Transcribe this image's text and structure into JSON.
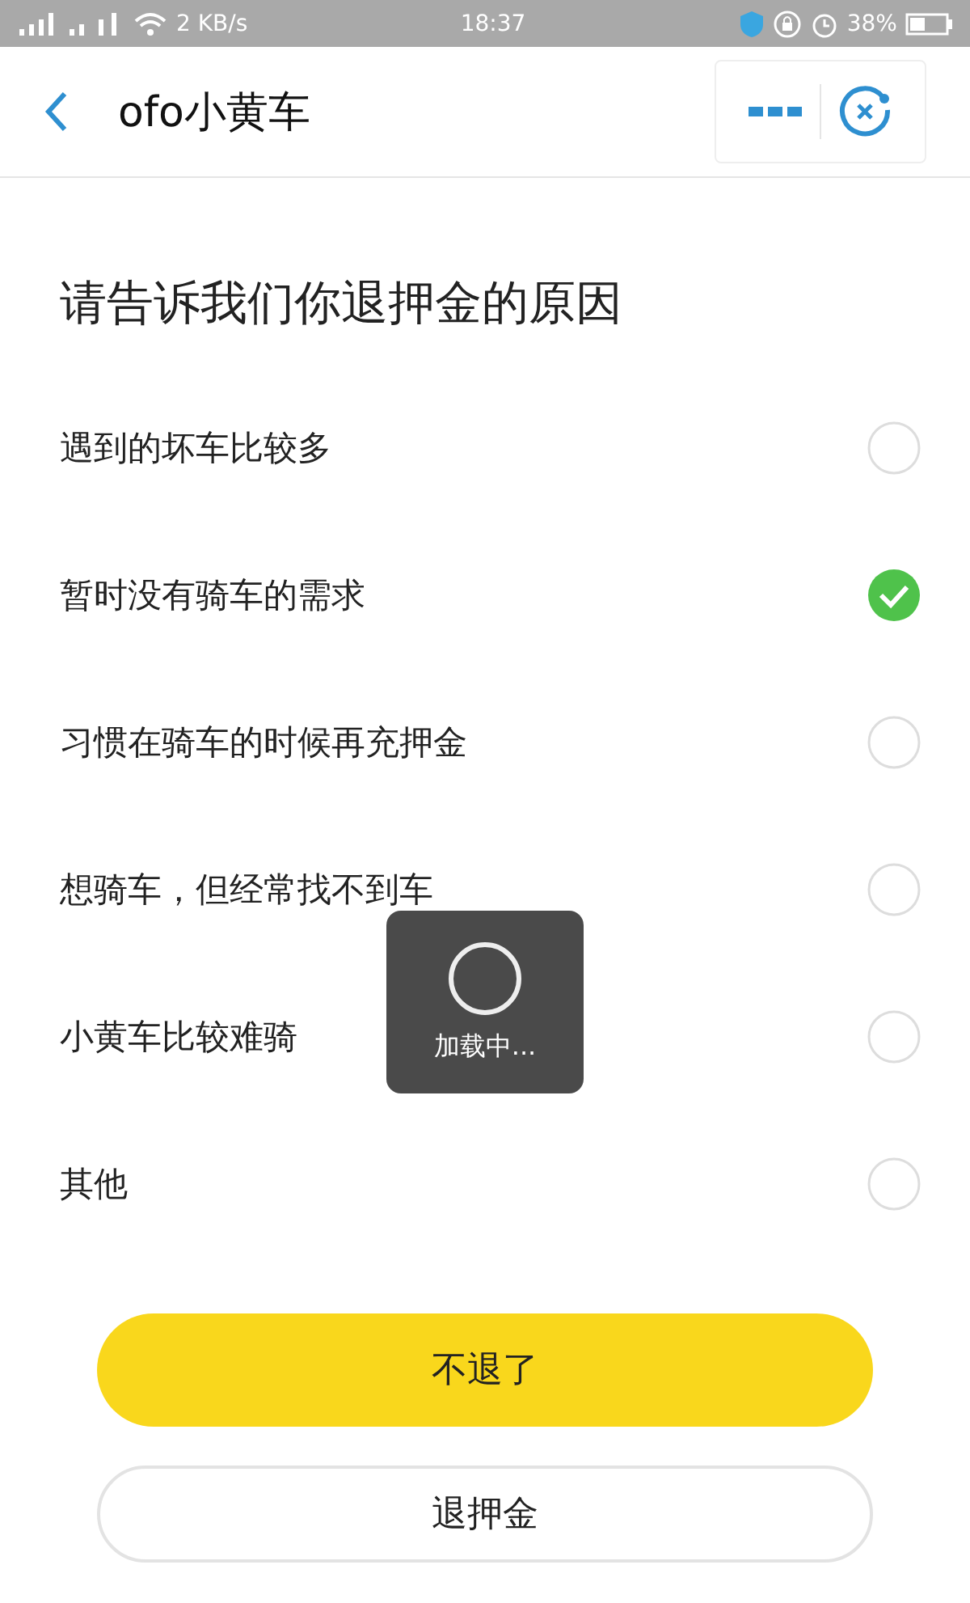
{
  "status_bar": {
    "network": "2 KB/s",
    "time": "18:37",
    "battery": "38%"
  },
  "header": {
    "title": "ofo小黄车"
  },
  "question": "请告诉我们你退押金的原因",
  "options": [
    {
      "label": "遇到的坏车比较多",
      "selected": false
    },
    {
      "label": "暂时没有骑车的需求",
      "selected": true
    },
    {
      "label": "习惯在骑车的时候再充押金",
      "selected": false
    },
    {
      "label": "想骑车，但经常找不到车",
      "selected": false
    },
    {
      "label": "小黄车比较难骑",
      "selected": false
    },
    {
      "label": "其他",
      "selected": false
    }
  ],
  "loading": {
    "text": "加载中..."
  },
  "buttons": [
    {
      "kind": "primary",
      "label": "不退了"
    },
    {
      "kind": "outline",
      "label": "退押金"
    }
  ]
}
